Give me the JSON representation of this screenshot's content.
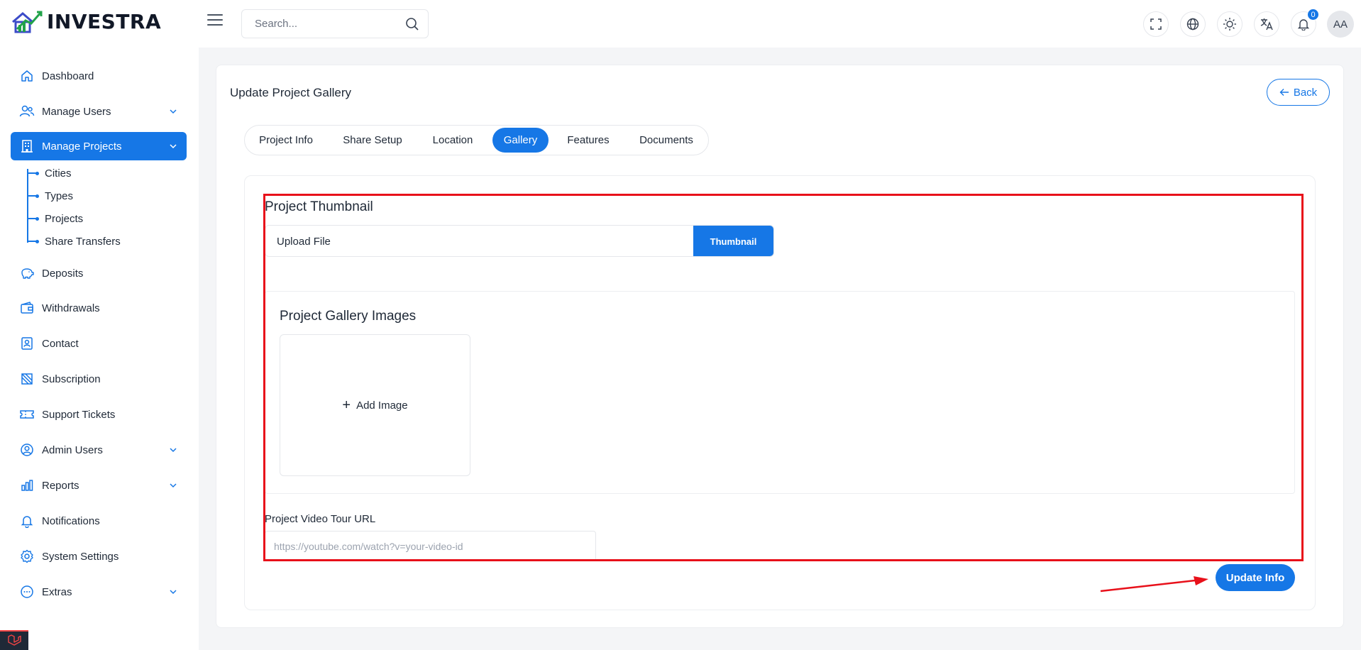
{
  "brand": {
    "name": "INVESTRA"
  },
  "header": {
    "search_placeholder": "Search...",
    "notification_count": "0",
    "avatar_initials": "AA"
  },
  "sidebar": {
    "items": [
      {
        "label": "Dashboard",
        "icon": "home-icon"
      },
      {
        "label": "Manage Users",
        "icon": "users-icon",
        "expandable": true
      },
      {
        "label": "Manage Projects",
        "icon": "building-icon",
        "expandable": true,
        "active": true
      },
      {
        "label": "Deposits",
        "icon": "piggy-bank-icon"
      },
      {
        "label": "Withdrawals",
        "icon": "wallet-icon"
      },
      {
        "label": "Contact",
        "icon": "contact-icon"
      },
      {
        "label": "Subscription",
        "icon": "subscription-icon"
      },
      {
        "label": "Support Tickets",
        "icon": "ticket-icon"
      },
      {
        "label": "Admin Users",
        "icon": "admin-user-icon",
        "expandable": true
      },
      {
        "label": "Reports",
        "icon": "chart-icon",
        "expandable": true
      },
      {
        "label": "Notifications",
        "icon": "bell-icon"
      },
      {
        "label": "System Settings",
        "icon": "gear-icon"
      },
      {
        "label": "Extras",
        "icon": "more-icon",
        "expandable": true
      }
    ],
    "sub_items": [
      "Cities",
      "Types",
      "Projects",
      "Share Transfers"
    ]
  },
  "page": {
    "title": "Update Project Gallery",
    "back_label": "Back",
    "tabs": [
      {
        "label": "Project Info"
      },
      {
        "label": "Share Setup"
      },
      {
        "label": "Location"
      },
      {
        "label": "Gallery",
        "active": true
      },
      {
        "label": "Features"
      },
      {
        "label": "Documents"
      }
    ]
  },
  "form": {
    "thumbnail_title": "Project Thumbnail",
    "upload_text": "Upload File",
    "upload_button": "Thumbnail",
    "gallery_title": "Project Gallery Images",
    "add_image_label": "Add Image",
    "video_label": "Project Video Tour URL",
    "video_placeholder": "https://youtube.com/watch?v=your-video-id",
    "submit_label": "Update Info"
  },
  "colors": {
    "primary": "#1677e6",
    "highlight": "#e8101a"
  }
}
